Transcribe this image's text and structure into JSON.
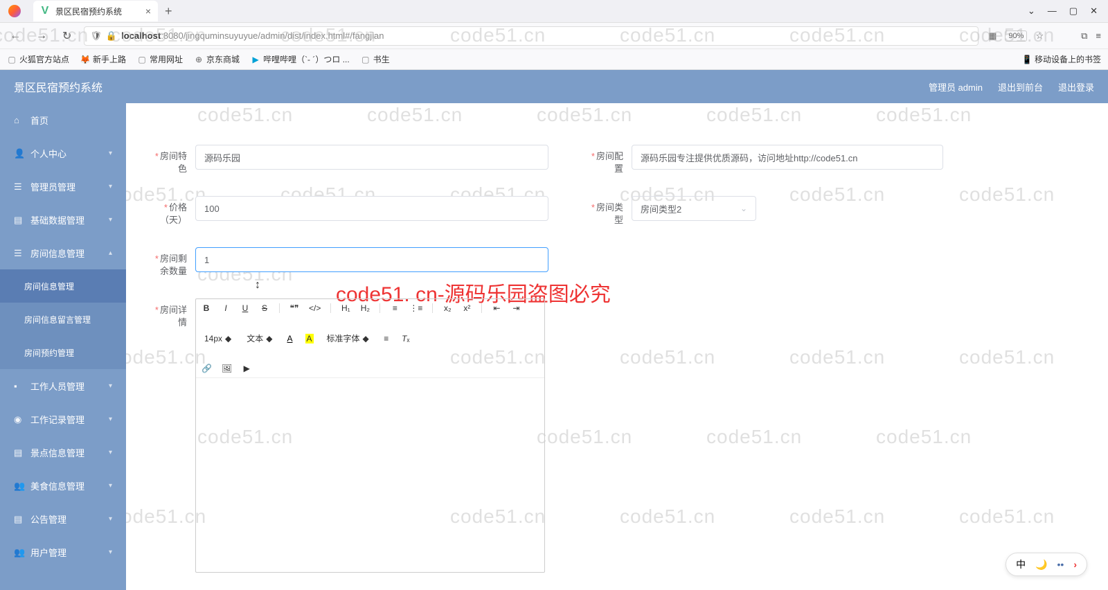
{
  "browser": {
    "tab_title": "景区民宿预约系统",
    "url_host": "localhost",
    "url_port": ":8080",
    "url_path": "/jingquminsuyuyue/admin/dist/index.html#/fangjian",
    "zoom": "90%",
    "bookmarks": {
      "b1": "火狐官方站点",
      "b2": "新手上路",
      "b3": "常用网址",
      "b4": "京东商城",
      "b5": "哔哩哔哩（`- ´）つロ ...",
      "b6": "书生",
      "b_right": "移动设备上的书签"
    }
  },
  "header": {
    "brand": "景区民宿预约系统",
    "user": "管理员 admin",
    "exit_front": "退出到前台",
    "logout": "退出登录"
  },
  "sidebar": {
    "home": "首页",
    "personal": "个人中心",
    "admin": "管理员管理",
    "base": "基础数据管理",
    "room": "房间信息管理",
    "room_sub1": "房间信息管理",
    "room_sub2": "房间信息留言管理",
    "room_sub3": "房间预约管理",
    "staff": "工作人员管理",
    "worklog": "工作记录管理",
    "spot": "景点信息管理",
    "food": "美食信息管理",
    "notice": "公告管理",
    "user": "用户管理"
  },
  "form": {
    "room_feature_label": "房间特色",
    "room_feature_value": "源码乐园",
    "room_config_label": "房间配置",
    "room_config_value": "源码乐园专注提供优质源码，访问地址http://code51.cn",
    "price_label": "价格（天）",
    "price_value": "100",
    "room_type_label": "房间类型",
    "room_type_value": "房间类型2",
    "remain_label": "房间剩余数量",
    "remain_value": "1",
    "detail_label": "房间详情"
  },
  "editor": {
    "font_size": "14px",
    "block": "文本",
    "font_family": "标准字体"
  },
  "watermark_text": "code51.cn",
  "red_text": "code51. cn-源码乐园盗图必究",
  "ime": {
    "cn": "中"
  }
}
